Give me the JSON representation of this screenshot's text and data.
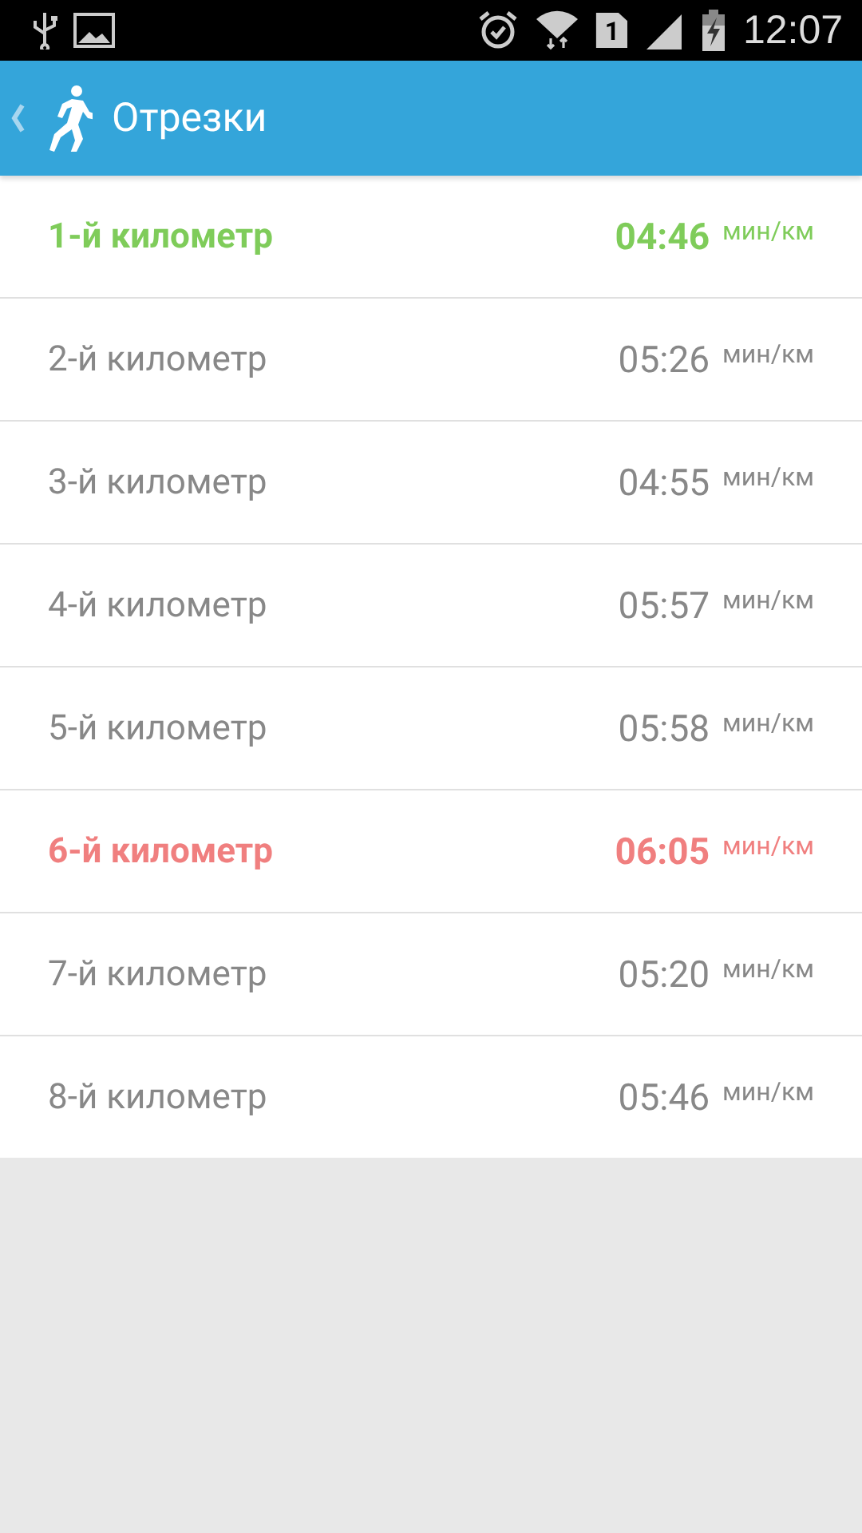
{
  "status_bar": {
    "sim_slot": "1",
    "time": "12:07"
  },
  "header": {
    "title": "Отрезки"
  },
  "splits": [
    {
      "label": "1-й километр",
      "pace": "04:46",
      "unit": "мин/км",
      "kind": "fastest"
    },
    {
      "label": "2-й километр",
      "pace": "05:26",
      "unit": "мин/км",
      "kind": "normal"
    },
    {
      "label": "3-й километр",
      "pace": "04:55",
      "unit": "мин/км",
      "kind": "normal"
    },
    {
      "label": "4-й километр",
      "pace": "05:57",
      "unit": "мин/км",
      "kind": "normal"
    },
    {
      "label": "5-й километр",
      "pace": "05:58",
      "unit": "мин/км",
      "kind": "normal"
    },
    {
      "label": "6-й километр",
      "pace": "06:05",
      "unit": "мин/км",
      "kind": "slowest"
    },
    {
      "label": "7-й километр",
      "pace": "05:20",
      "unit": "мин/км",
      "kind": "normal"
    },
    {
      "label": "8-й километр",
      "pace": "05:46",
      "unit": "мин/км",
      "kind": "normal"
    }
  ]
}
